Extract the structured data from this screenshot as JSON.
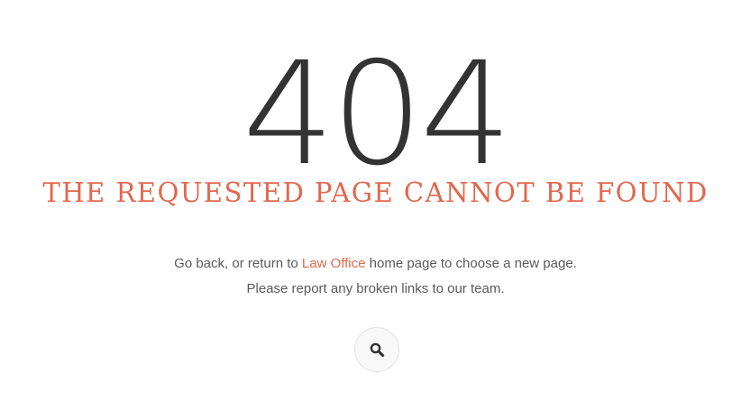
{
  "error": {
    "code": "404",
    "title": "THE REQUESTED PAGE CANNOT BE FOUND"
  },
  "message": {
    "line1_before": "Go back, or return to ",
    "line1_link": "Law Office",
    "line1_after": " home page to choose a new page.",
    "line2": "Please report any broken links to our team."
  },
  "search_button": {
    "icon": "search-icon"
  },
  "colors": {
    "accent": "#e2684e",
    "heading": "#333333",
    "text": "#5a5a5a"
  }
}
